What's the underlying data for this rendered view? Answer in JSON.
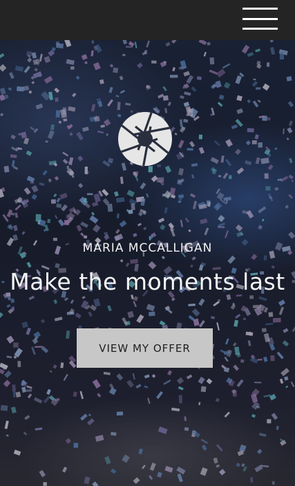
{
  "header": {
    "menu_icon": "hamburger-menu-icon"
  },
  "hero": {
    "logo_icon": "camera-aperture-icon",
    "background": "confetti-photo",
    "subtitle": "MARIA MCCALLIGAN",
    "headline": "Make the moments last",
    "cta_label": "VIEW MY OFFER"
  },
  "colors": {
    "topbar": "#242424",
    "button_bg": "#c7c7c7",
    "button_text": "#1e1e1e",
    "text": "#f5f5f5"
  }
}
